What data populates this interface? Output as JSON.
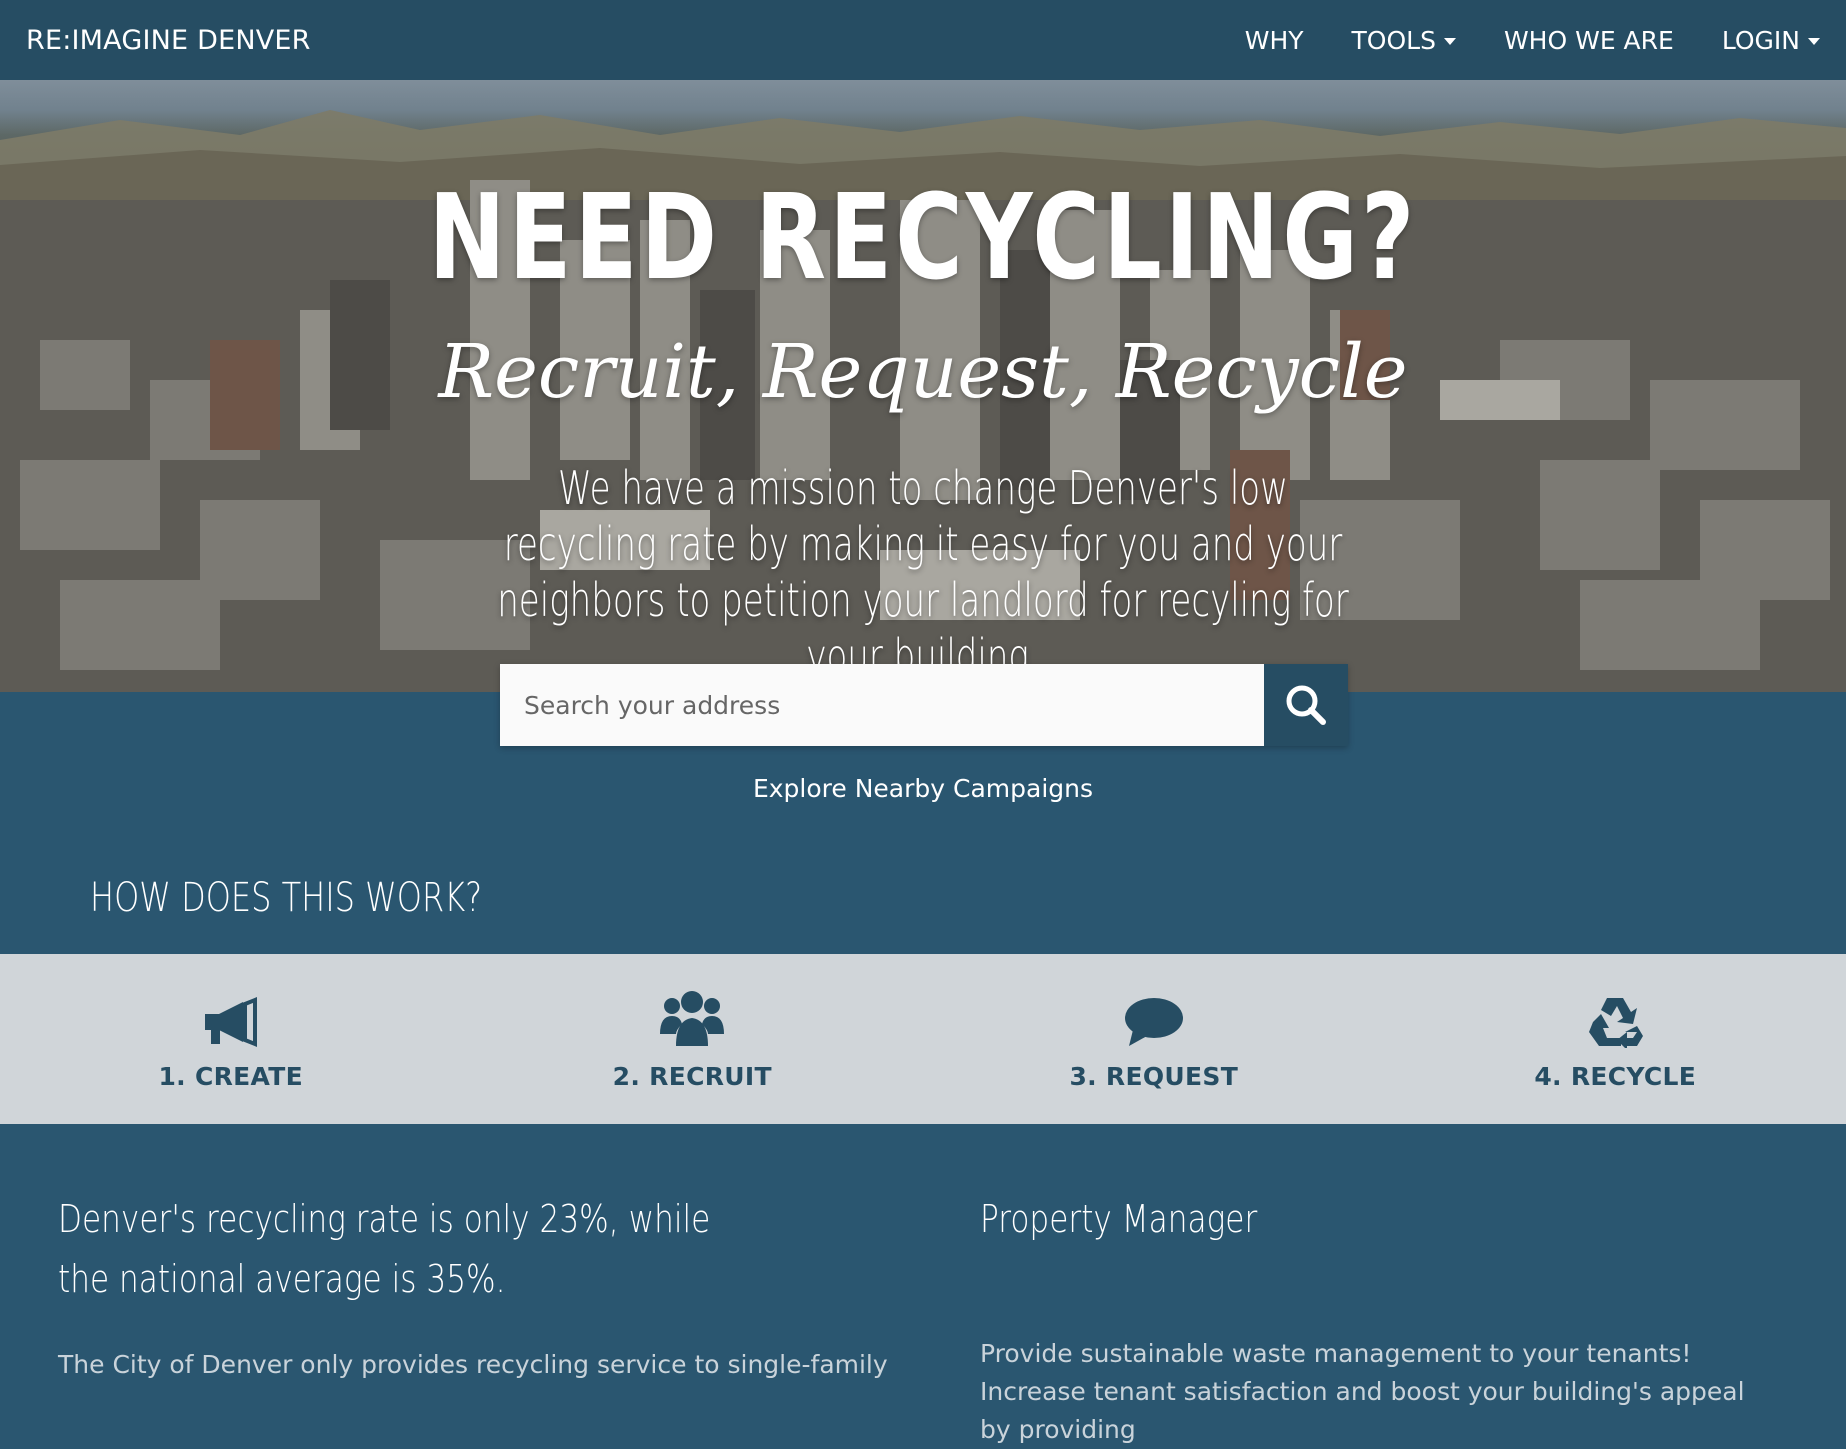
{
  "nav": {
    "brand": "RE:IMAGINE DENVER",
    "items": [
      {
        "label": "WHY"
      },
      {
        "label": "TOOLS"
      },
      {
        "label": "WHO WE ARE"
      },
      {
        "label": "LOGIN"
      }
    ]
  },
  "hero": {
    "title": "NEED RECYCLING?",
    "subtitle": "Recruit, Request, Recycle",
    "mission": "We have a mission to change Denver's low recycling rate by making it easy for you and your neighbors to petition your landlord for recyling for your building."
  },
  "search": {
    "placeholder": "Search your address",
    "value": ""
  },
  "explore_label": "Explore Nearby Campaigns",
  "how_heading": "HOW DOES THIS WORK?",
  "steps": [
    {
      "label": "1. CREATE",
      "icon": "megaphone-icon"
    },
    {
      "label": "2. RECRUIT",
      "icon": "users-icon"
    },
    {
      "label": "3. REQUEST",
      "icon": "comment-icon"
    },
    {
      "label": "4. RECYCLE",
      "icon": "recycle-icon"
    }
  ],
  "left_col": {
    "heading": "Denver's recycling rate is only 23%, while the national average is 35%.",
    "text": "The City of Denver only provides recycling service to single-family"
  },
  "right_col": {
    "heading": "Property Manager",
    "text": "Provide sustainable waste management to your tenants! Increase tenant satisfaction and boost your building's appeal by providing"
  },
  "colors": {
    "navbar": "#264d63",
    "section": "#2a5670",
    "steps_bg": "#d0d5d9",
    "accent": "#264d63"
  }
}
